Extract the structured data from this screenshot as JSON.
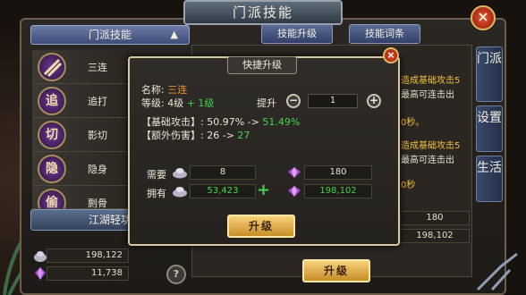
{
  "window": {
    "title": "门派技能",
    "close_symbol": "×"
  },
  "left": {
    "header": "门派技能",
    "collapse_symbol": "▲",
    "skills": [
      {
        "glyph": "",
        "label": "三连"
      },
      {
        "glyph": "追",
        "label": "追打"
      },
      {
        "glyph": "切",
        "label": "影切"
      },
      {
        "glyph": "隐",
        "label": "隐身"
      },
      {
        "glyph": "偷",
        "label": "剽骨"
      }
    ],
    "jianghu": "江湖轻功",
    "resources": [
      "198,122",
      "11,738"
    ],
    "help_symbol": "?"
  },
  "tabs": [
    "技能升级",
    "技能词条"
  ],
  "side_tabs": [
    "门派",
    "设置",
    "生活"
  ],
  "background_panel": {
    "line1": "造成基础攻击5",
    "line2": "最高可连击出",
    "line3": "0秒。",
    "line4": "造成基础攻击5",
    "line5": "最高可连击出",
    "line6": "0秒",
    "box1": "180",
    "box2": "198,102",
    "upgrade": "升级"
  },
  "modal": {
    "title": "快捷升级",
    "close_symbol": "×",
    "name_label": "名称:",
    "name_value": "三连",
    "level_label": "等级:",
    "level_value": "4级",
    "level_plus": "+ 1级",
    "raise_label": "提升",
    "step_minus": "−",
    "step_value": "1",
    "step_plus": "+",
    "stat1_label": "【基础攻击】:",
    "stat1_from": "50.97%",
    "stat1_arrow": "->",
    "stat1_to": "51.49%",
    "stat2_label": "【额外伤害】:",
    "stat2_from": "26",
    "stat2_arrow": "->",
    "stat2_to": "27",
    "need_label": "需要",
    "have_label": "拥有",
    "need_silver": "8",
    "need_gem": "180",
    "have_silver": "53,423",
    "have_gem": "198,102",
    "add_symbol": "+",
    "upgrade": "升级"
  }
}
